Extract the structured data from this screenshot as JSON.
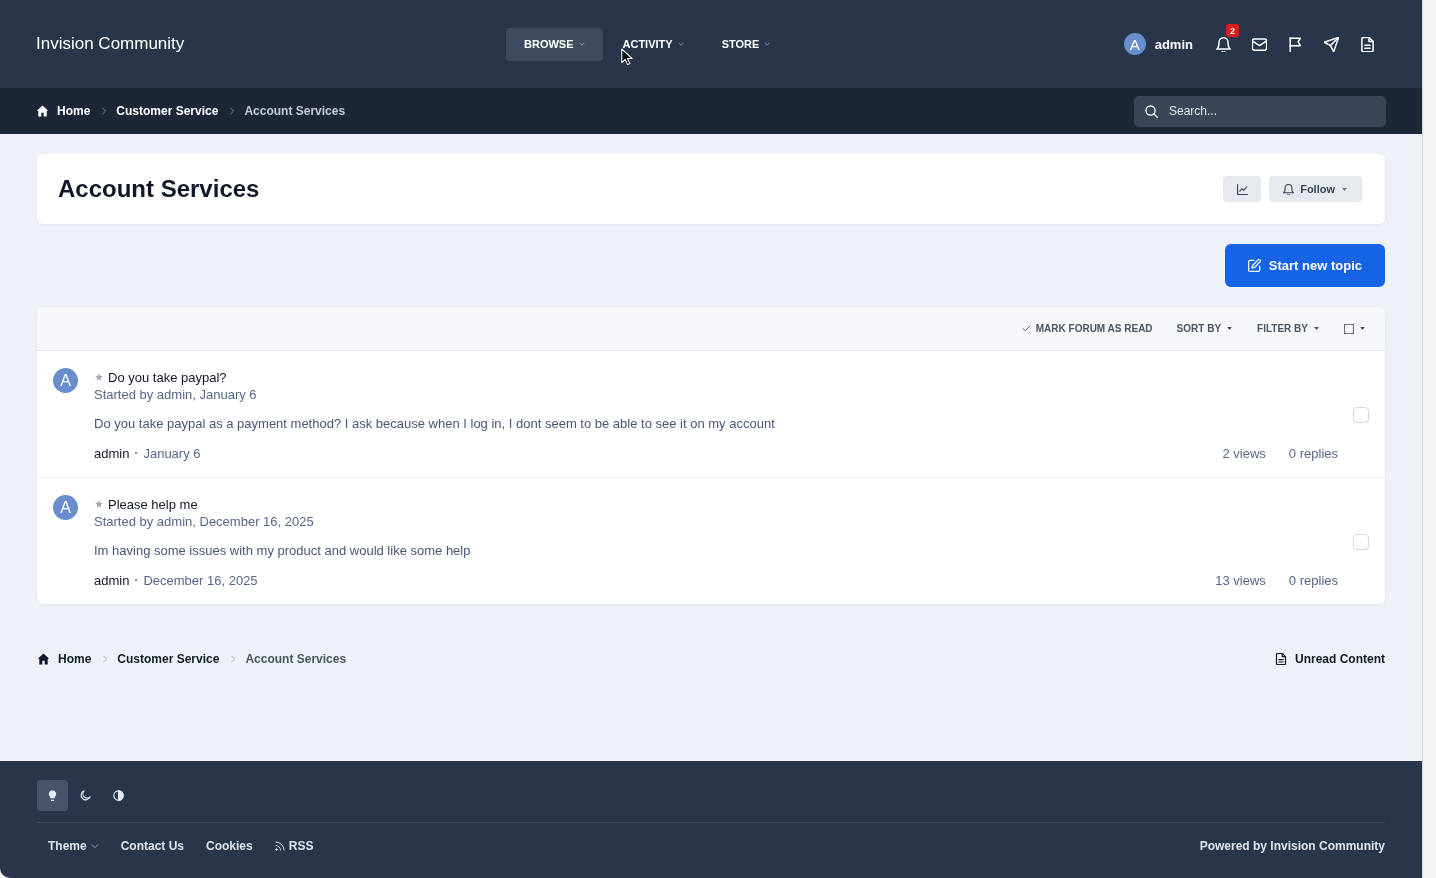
{
  "header": {
    "site_name": "Invision Community",
    "nav": [
      {
        "label": "BROWSE",
        "selected": true
      },
      {
        "label": "ACTIVITY",
        "selected": false
      },
      {
        "label": "STORE",
        "selected": false
      }
    ],
    "user": {
      "avatar_letter": "A",
      "name": "admin"
    },
    "icons": [
      {
        "kind": "bell",
        "badge": "2"
      },
      {
        "kind": "mail"
      },
      {
        "kind": "flag"
      },
      {
        "kind": "send"
      },
      {
        "kind": "document"
      }
    ]
  },
  "breadcrumb": [
    "Home",
    "Customer Service",
    "Account Services"
  ],
  "search": {
    "placeholder": "Search..."
  },
  "forum": {
    "title": "Account Services",
    "follow_button": "Follow",
    "start_topic_button": "Start new topic",
    "toolbar": [
      {
        "kind": "mark_read",
        "label": "MARK FORUM AS READ"
      },
      {
        "kind": "menu",
        "label": "SORT BY"
      },
      {
        "kind": "menu",
        "label": "FILTER BY"
      },
      {
        "kind": "select",
        "checked": false
      }
    ],
    "topics": [
      {
        "avatar_letter": "A",
        "title": "Do you take paypal?",
        "started": "Started by admin, January 6",
        "snippet": "Do you take paypal as a payment method? I ask because when I log in, I dont seem to be able to see it on my account",
        "last_poster": "admin",
        "last_date": "January 6",
        "views": "2 views",
        "replies": "0 replies",
        "checked": false
      },
      {
        "avatar_letter": "A",
        "title": "Please help me",
        "started": "Started by admin, December 16, 2025",
        "snippet": "Im having some issues with my product and would like some help",
        "last_poster": "admin",
        "last_date": "December 16, 2025",
        "views": "13 views",
        "replies": "0 replies",
        "checked": false
      }
    ]
  },
  "bottom_breadcrumb": [
    "Home",
    "Customer Service",
    "Account Services"
  ],
  "unread_link": "Unread Content",
  "footer": {
    "theme_modes": [
      {
        "kind": "light",
        "selected": true
      },
      {
        "kind": "dark",
        "selected": false
      },
      {
        "kind": "system",
        "selected": false
      }
    ],
    "links": [
      {
        "kind": "menu",
        "label": "Theme"
      },
      {
        "kind": "plain",
        "label": "Contact Us"
      },
      {
        "kind": "plain",
        "label": "Cookies"
      },
      {
        "kind": "feed",
        "label": "RSS"
      }
    ],
    "powered_by": "Powered by Invision Community"
  }
}
